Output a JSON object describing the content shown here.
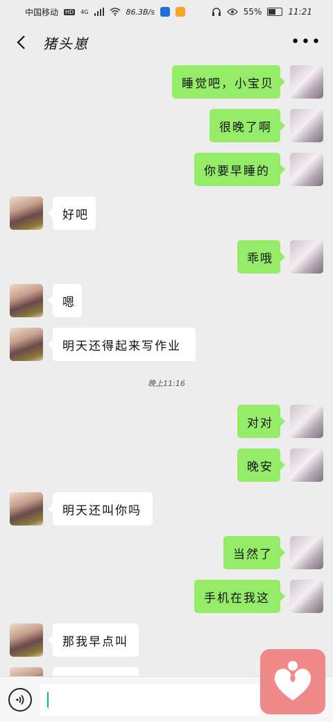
{
  "status_bar": {
    "carrier": "中国移动",
    "hd_badge": "HD",
    "network": "4G",
    "speed": "86.3B/s",
    "battery_percent": "55%",
    "battery_level": 0.55,
    "time": "11:21"
  },
  "nav": {
    "title": "猪头崽"
  },
  "messages": [
    {
      "side": "right",
      "text": "睡觉吧，小宝贝"
    },
    {
      "side": "right",
      "text": "很晚了啊"
    },
    {
      "side": "right",
      "text": "你要早睡的"
    },
    {
      "side": "left",
      "text": "好吧"
    },
    {
      "side": "right",
      "text": "乖哦"
    },
    {
      "side": "left",
      "text": "嗯"
    },
    {
      "side": "left",
      "text": "明天还得起来写作业"
    },
    {
      "side": "time",
      "text": "晚上11:16"
    },
    {
      "side": "right",
      "text": "对对"
    },
    {
      "side": "right",
      "text": "晚安"
    },
    {
      "side": "left",
      "text": "明天还叫你吗"
    },
    {
      "side": "right",
      "text": "当然了"
    },
    {
      "side": "right",
      "text": "手机在我这"
    },
    {
      "side": "left",
      "text": "那我早点叫"
    },
    {
      "side": "left",
      "text": ""
    }
  ],
  "input": {
    "value": "",
    "placeholder": ""
  },
  "icons": {
    "back": "chevron-left-icon",
    "more": "more-dots-icon",
    "voice": "voice-icon",
    "widget": "heart-person-icon"
  },
  "colors": {
    "sent_bubble": "#95ec69",
    "received_bubble": "#ffffff",
    "background": "#ededed",
    "widget": "#f08a8a",
    "caret": "#07c160"
  }
}
